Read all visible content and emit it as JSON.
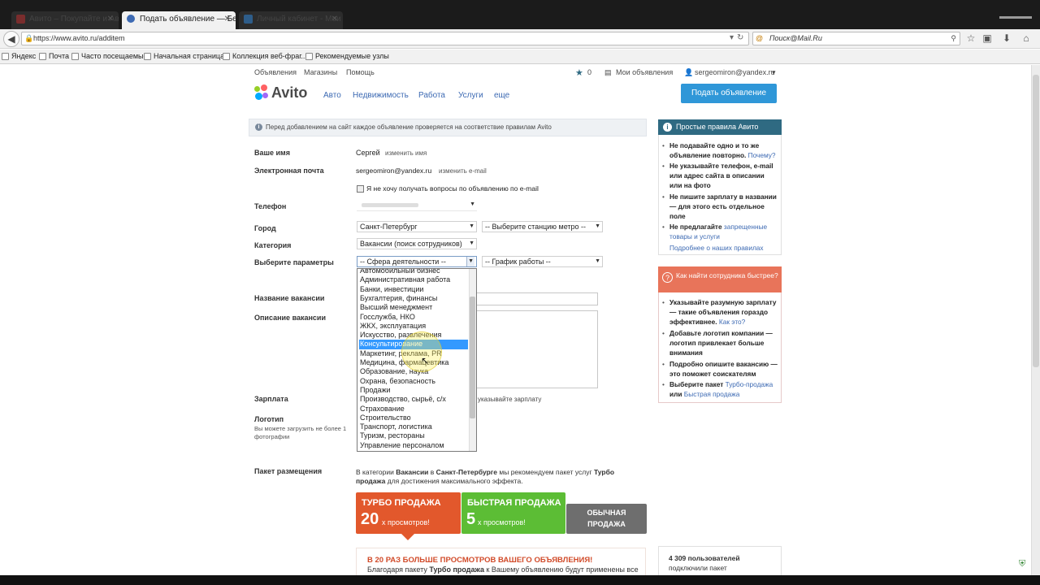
{
  "browser": {
    "tabs": [
      {
        "title": "Авито – Покупайте и Авито",
        "state": "inactive"
      },
      {
        "title": "Подать объявление — Бе...",
        "state": "active"
      },
      {
        "title": "Личный кабинет - Мои ...",
        "state": "inactive"
      }
    ],
    "new_tab": "+",
    "url": "https://www.avito.ru/additem",
    "search_placeholder": "Поиск@Mail.Ru",
    "bookmarks": [
      "Яндекс",
      "Почта",
      "Часто посещаемые",
      "Начальная страница",
      "Коллекция веб-фраг...",
      "Рекомендуемые узлы"
    ]
  },
  "topbar": {
    "links": [
      "Объявления",
      "Магазины",
      "Помощь"
    ],
    "favorites_count": "0",
    "my_ads": "Мои объявления",
    "user": "sergeomiron@yandex.ru"
  },
  "header": {
    "logo": "Avito",
    "nav": [
      "Авто",
      "Недвижимость",
      "Работа",
      "Услуги",
      "еще"
    ],
    "post_button": "Подать объявление"
  },
  "notice": "Перед добавлением на сайт каждое объявление проверяется на соответствие правилам Avito",
  "form": {
    "name_label": "Ваше имя",
    "name_value": "Сергей",
    "name_change": "изменить имя",
    "email_label": "Электронная почта",
    "email_value": "sergeomiron@yandex.ru",
    "email_change": "изменить e-mail",
    "no_questions": "Я не хочу получать вопросы по объявлению по e-mail",
    "phone_label": "Телефон",
    "city_label": "Город",
    "city_value": "Санкт-Петербург",
    "metro_value": "-- Выберите станцию метро --",
    "category_label": "Категория",
    "category_value": "Вакансии (поиск сотрудников)",
    "params_label": "Выберите параметры",
    "sphere_value": "-- Сфера деятельности --",
    "schedule_value": "-- График работы --",
    "vacancy_label": "Название вакансии",
    "description_label": "Описание вакансии",
    "salary_label": "Зарплата",
    "salary_hint": "указывайте зарплату",
    "logo_label": "Логотип",
    "logo_hint_1": "Вы можете загрузить не более 1",
    "logo_hint_2": "фотографии",
    "package_label": "Пакет размещения",
    "package_desc_parts": [
      "В категории ",
      "Вакансии",
      " в ",
      "Санкт-Петербурге",
      " мы рекомендуем пакет услуг ",
      "Турбо продажа",
      " для достижения максимального эффекта."
    ]
  },
  "dropdown": {
    "options": [
      "Автомобильный бизнес",
      "Административная работа",
      "Банки, инвестиции",
      "Бухгалтерия, финансы",
      "Высший менеджмент",
      "Госслужба, НКО",
      "ЖКХ, эксплуатация",
      "Искусство, развлечения",
      "Консультирование",
      "Маркетинг, реклама, PR",
      "Медицина, фармацевтика",
      "Образование, наука",
      "Охрана, безопасность",
      "Продажи",
      "Производство, сырьё, с/х",
      "Страхование",
      "Строительство",
      "Транспорт, логистика",
      "Туризм, рестораны",
      "Управление персоналом"
    ],
    "selected_index": 8
  },
  "packages": {
    "turbo": {
      "title": "ТУРБО ПРОДАЖА",
      "number": "20",
      "suffix": "х просмотров!"
    },
    "fast": {
      "title": "БЫСТРАЯ ПРОДАЖА",
      "number": "5",
      "suffix": "х просмотров!"
    },
    "normal": {
      "line1": "ОБЫЧНАЯ",
      "line2": "ПРОДАЖА"
    },
    "promo_title": "В 20 РАЗ БОЛЬШЕ ПРОСМОТРОВ ВАШЕГО ОБЪЯВЛЕНИЯ!",
    "promo_text_parts": [
      "Благодаря пакету ",
      "Турбо продажа",
      " к Вашему объявлению будут применены все"
    ]
  },
  "sidebar": {
    "rules_title": "Простые правила Авито",
    "rules": [
      {
        "text": "Не подавайте одно и то же объявление повторно.",
        "link": "Почему?"
      },
      {
        "text": "Не указывайте телефон, e-mail или адрес сайта в описании или на фото",
        "link": ""
      },
      {
        "text": "Не пишите зарплату в названии — для этого есть отдельное поле",
        "link": ""
      },
      {
        "text": "Не предлагайте ",
        "link": "запрещенные товары и услуги"
      }
    ],
    "rules_more": "Подробнее о наших правилах",
    "tips_title": "Как найти сотрудника быстрее?",
    "tips": [
      {
        "text": "Указывайте разумную зарплату — такие объявления гораздо эффективнее.",
        "link": "Как это?"
      },
      {
        "text": "Добавьте логотип компании — логотип привлекает больше внимания",
        "link": ""
      },
      {
        "text": "Подробно опишите вакансию — это поможет соискателям",
        "link": ""
      },
      {
        "text_before": "Выберите пакет ",
        "link1": "Турбо-продажа",
        "mid": " или ",
        "link2": "Быстрая продажа"
      }
    ],
    "stats_line1": "4 309 пользователей",
    "stats_line2": "подключили пакет"
  }
}
